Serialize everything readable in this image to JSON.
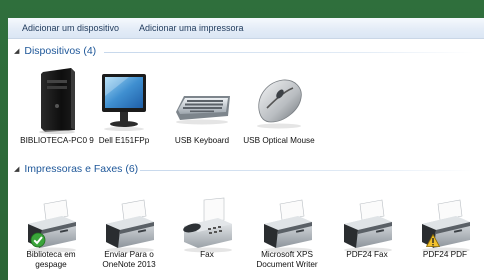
{
  "toolbar": {
    "add_device": "Adicionar um dispositivo",
    "add_printer": "Adicionar uma impressora"
  },
  "devices": {
    "header": "Dispositivos (4)",
    "items": [
      {
        "label": "BIBLIOTECA-PC0 9",
        "icon": "computer-tower-icon"
      },
      {
        "label": "Dell E151FPp",
        "icon": "monitor-icon"
      },
      {
        "label": "USB Keyboard",
        "icon": "keyboard-icon"
      },
      {
        "label": "USB Optical Mouse",
        "icon": "mouse-icon"
      }
    ]
  },
  "printers": {
    "header": "Impressoras e Faxes (6)",
    "items": [
      {
        "label": "Biblioteca em gespage",
        "icon": "printer-icon",
        "badge": "default-check"
      },
      {
        "label": "Enviar Para o OneNote 2013",
        "icon": "printer-icon"
      },
      {
        "label": "Fax",
        "icon": "fax-icon"
      },
      {
        "label": "Microsoft XPS Document Writer",
        "icon": "printer-icon"
      },
      {
        "label": "PDF24 Fax",
        "icon": "printer-icon"
      },
      {
        "label": "PDF24 PDF",
        "icon": "printer-icon",
        "badge": "warning"
      }
    ]
  },
  "colors": {
    "section_header": "#1e5799",
    "desktop": "#2d6b3a",
    "check_badge": "#3aa53a",
    "warning_badge": "#f2c12e"
  }
}
